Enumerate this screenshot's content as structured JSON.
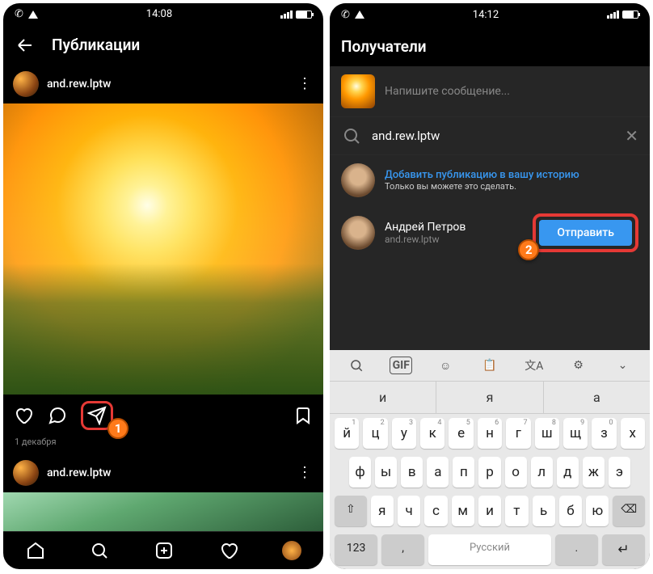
{
  "left": {
    "status": {
      "time": "14:08"
    },
    "header": {
      "title": "Публикации"
    },
    "post": {
      "username": "and.rew.lptw",
      "date": "1 декабря"
    },
    "post2": {
      "username": "and.rew.lptw"
    },
    "badge1": "1"
  },
  "right": {
    "status": {
      "time": "14:12"
    },
    "header": {
      "title": "Получатели"
    },
    "compose": {
      "placeholder": "Напишите сообщение..."
    },
    "search": {
      "value": "and.rew.lptw"
    },
    "story": {
      "title": "Добавить публикацию в вашу историю",
      "sub": "Только вы можете это сделать."
    },
    "user": {
      "name": "Андрей Петров",
      "handle": "and.rew.lptw",
      "send": "Отправить"
    },
    "badge2": "2",
    "suggest": [
      "и",
      "я",
      "а"
    ],
    "keys": {
      "r1": [
        "й",
        "ц",
        "у",
        "к",
        "е",
        "н",
        "г",
        "ш",
        "щ",
        "з",
        "х"
      ],
      "r2": [
        "ф",
        "ы",
        "в",
        "а",
        "п",
        "р",
        "о",
        "л",
        "д",
        "ж",
        "э"
      ],
      "r3": [
        "я",
        "ч",
        "с",
        "м",
        "и",
        "т",
        "ь",
        "б",
        "ю"
      ],
      "num": "123",
      "space": "Русский"
    }
  }
}
